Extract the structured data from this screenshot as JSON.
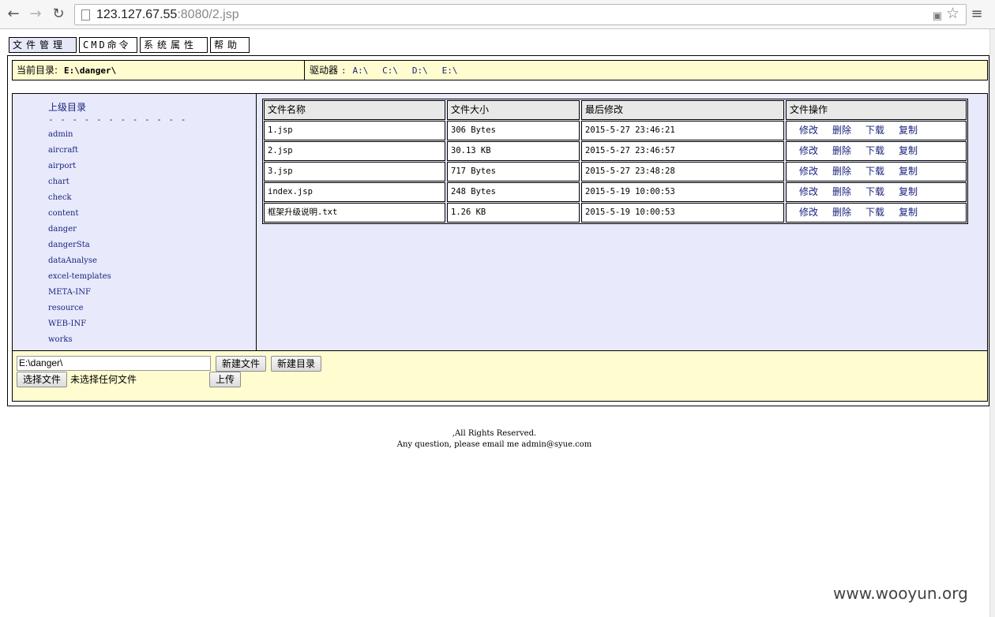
{
  "browser": {
    "url_host": "123.127.67.55",
    "url_rest": ":8080/2.jsp"
  },
  "tabs": [
    "文件管理",
    "CMD命令",
    "系统属性",
    "帮助"
  ],
  "dirbar": {
    "current_label": "当前目录:",
    "current_value": "E:\\danger\\",
    "drives_label": "驱动器",
    "drives_sep": ":",
    "drives": [
      "A:\\",
      "C:\\",
      "D:\\",
      "E:\\"
    ]
  },
  "sidebar": {
    "parent_dir": "上级目录",
    "dashes": "- - - - - - - - - - - -",
    "dirs": [
      "admin",
      "aircraft",
      "airport",
      "chart",
      "check",
      "content",
      "danger",
      "dangerSta",
      "dataAnalyse",
      "excel-templates",
      "META-INF",
      "resource",
      "WEB-INF",
      "works"
    ]
  },
  "table": {
    "headers": [
      "文件名称",
      "文件大小",
      "最后修改",
      "文件操作"
    ],
    "operations": [
      "修改",
      "删除",
      "下载",
      "复制"
    ],
    "rows": [
      {
        "name": "1.jsp",
        "size": "306 Bytes",
        "modified": "2015-5-27 23:46:21"
      },
      {
        "name": "2.jsp",
        "size": "30.13 KB",
        "modified": "2015-5-27 23:46:57"
      },
      {
        "name": "3.jsp",
        "size": "717 Bytes",
        "modified": "2015-5-27 23:48:28"
      },
      {
        "name": "index.jsp",
        "size": "248 Bytes",
        "modified": "2015-5-19 10:00:53"
      },
      {
        "name": "框架升级说明.txt",
        "size": "1.26 KB",
        "modified": "2015-5-19 10:00:53"
      }
    ]
  },
  "actions": {
    "path_value": "E:\\danger\\",
    "new_file": "新建文件",
    "new_dir": "新建目录",
    "choose_file": "选择文件",
    "no_file": "未选择任何文件",
    "upload": "上传"
  },
  "footer": {
    "line1": ",All Rights Reserved.",
    "line2": "Any question, please email me admin@syue.com"
  },
  "watermark": "www.wooyun.org"
}
